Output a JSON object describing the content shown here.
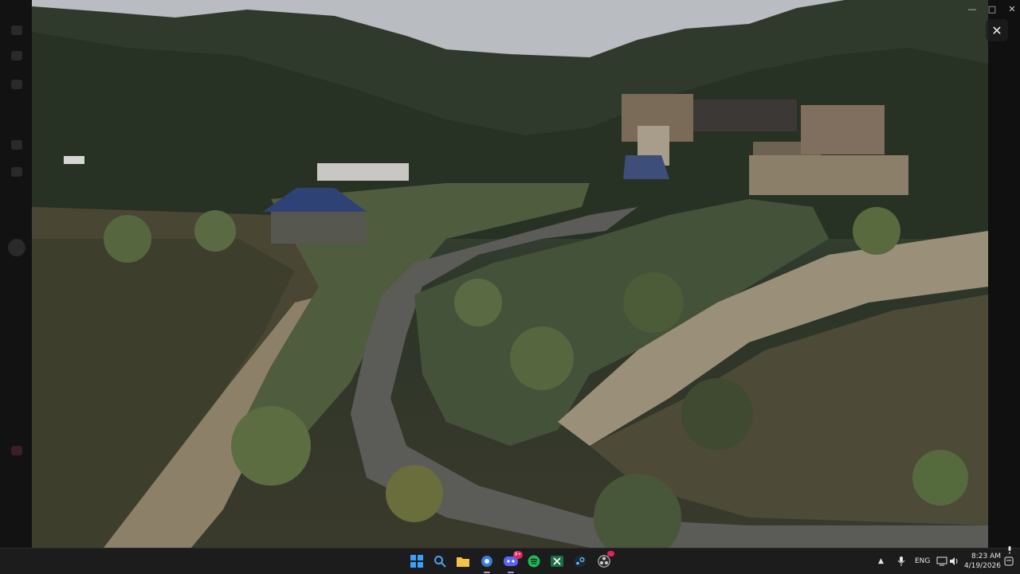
{
  "window": {
    "minimize_icon": "minimize-icon",
    "maximize_icon": "maximize-icon",
    "close_icon": "close-icon",
    "close_glyph": "✕"
  },
  "viewer": {
    "image_content": "mountain-terraced-village-photo"
  },
  "taskbar": {
    "apps": [
      {
        "name": "start",
        "icon": "windows-start-icon",
        "color": "#3aa0ff"
      },
      {
        "name": "search",
        "icon": "search-icon",
        "color": "#3a8bd8"
      },
      {
        "name": "file-explorer",
        "icon": "folder-icon",
        "color": "#f6c445"
      },
      {
        "name": "browser",
        "icon": "browser-icon",
        "color": "#3d7bd8"
      },
      {
        "name": "discord",
        "icon": "discord-icon",
        "color": "#5865f2",
        "badge": "9+"
      },
      {
        "name": "spotify",
        "icon": "spotify-icon",
        "color": "#1db954"
      },
      {
        "name": "excel",
        "icon": "excel-icon",
        "color": "#1d6f42"
      },
      {
        "name": "steam",
        "icon": "steam-icon",
        "color": "#66c0f4"
      },
      {
        "name": "obs",
        "icon": "obs-icon",
        "color": "#d0d0d0",
        "badge": ""
      }
    ],
    "tray": {
      "chevron_icon": "chevron-up-icon",
      "mic_icon": "microphone-icon",
      "language": "ENG",
      "network_icon": "network-icon",
      "volume_icon": "volume-icon",
      "battery_icon": "battery-icon",
      "time": "8:23 AM",
      "date": "4/19/2026",
      "notification_icon": "notification-icon"
    }
  }
}
